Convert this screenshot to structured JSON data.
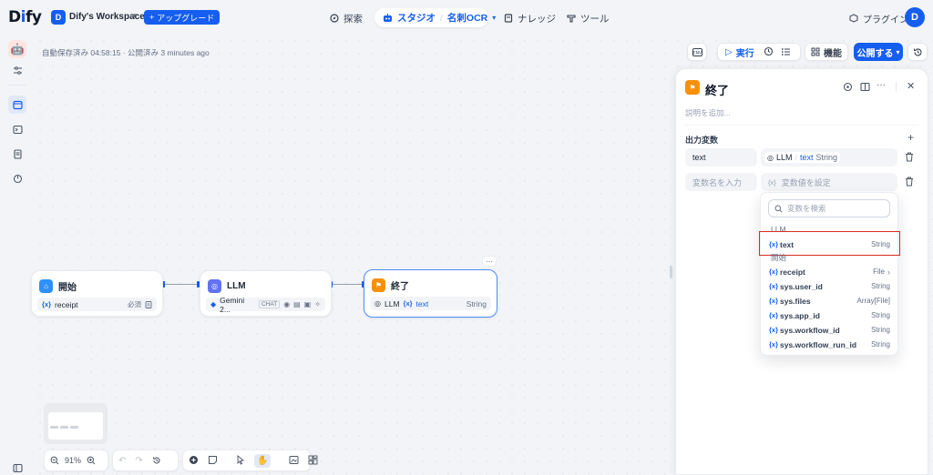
{
  "app": {
    "logo_pre": "D",
    "logo_mid": "i",
    "logo_post": "fy"
  },
  "workspace": {
    "badge": "D",
    "name": "Dify's Workspace",
    "upgrade": "アップグレード"
  },
  "nav": {
    "explore": "探索",
    "studio": "スタジオ",
    "app_name": "名刺OCR",
    "knowledge": "ナレッジ",
    "tools": "ツール"
  },
  "header_right": {
    "plugins": "プラグイン",
    "avatar": "D"
  },
  "autosave": "自動保存済み 04:58:15 · 公開済み 3 minutes ago",
  "toolbar": {
    "run": "実行",
    "features": "機能",
    "publish": "公開する"
  },
  "nodes": {
    "start": {
      "title": "開始",
      "var_icon": "{x}",
      "var": "receipt",
      "badge": "必須"
    },
    "llm": {
      "title": "LLM",
      "model": "Gemini 2...",
      "mode": "CHAT"
    },
    "end": {
      "title": "終了",
      "src": "LLM",
      "var_icon": "{x}",
      "var": "text",
      "type": "String"
    }
  },
  "panel": {
    "title": "終了",
    "desc_placeholder": "説明を追加...",
    "output_label": "出力変数",
    "row1_name": "text",
    "row1_src": "LLM",
    "row1_sep": "/",
    "row1_var": "text",
    "row1_type": "String",
    "row2_name_placeholder": "変数名を入力",
    "row2_value_icon": "{x}",
    "row2_value_placeholder": "変数値を設定"
  },
  "dropdown": {
    "search_placeholder": "変数を検索",
    "groups": [
      {
        "label": "LLM",
        "items": [
          {
            "name": "text",
            "type": "String"
          }
        ]
      },
      {
        "label": "開始",
        "items": [
          {
            "name": "receipt",
            "type": "File"
          },
          {
            "name": "sys.user_id",
            "type": "String"
          },
          {
            "name": "sys.files",
            "type": "Array[File]"
          },
          {
            "name": "sys.app_id",
            "type": "String"
          },
          {
            "name": "sys.workflow_id",
            "type": "String"
          },
          {
            "name": "sys.workflow_run_id",
            "type": "String"
          }
        ]
      }
    ],
    "item_icon": "{x}"
  },
  "zoom": {
    "level": "91%"
  },
  "colors": {
    "accent": "#155eef",
    "end_node": "#f79009",
    "llm_node": "#6172f3",
    "start_node": "#2e90fa",
    "highlight": "#d92d20"
  }
}
